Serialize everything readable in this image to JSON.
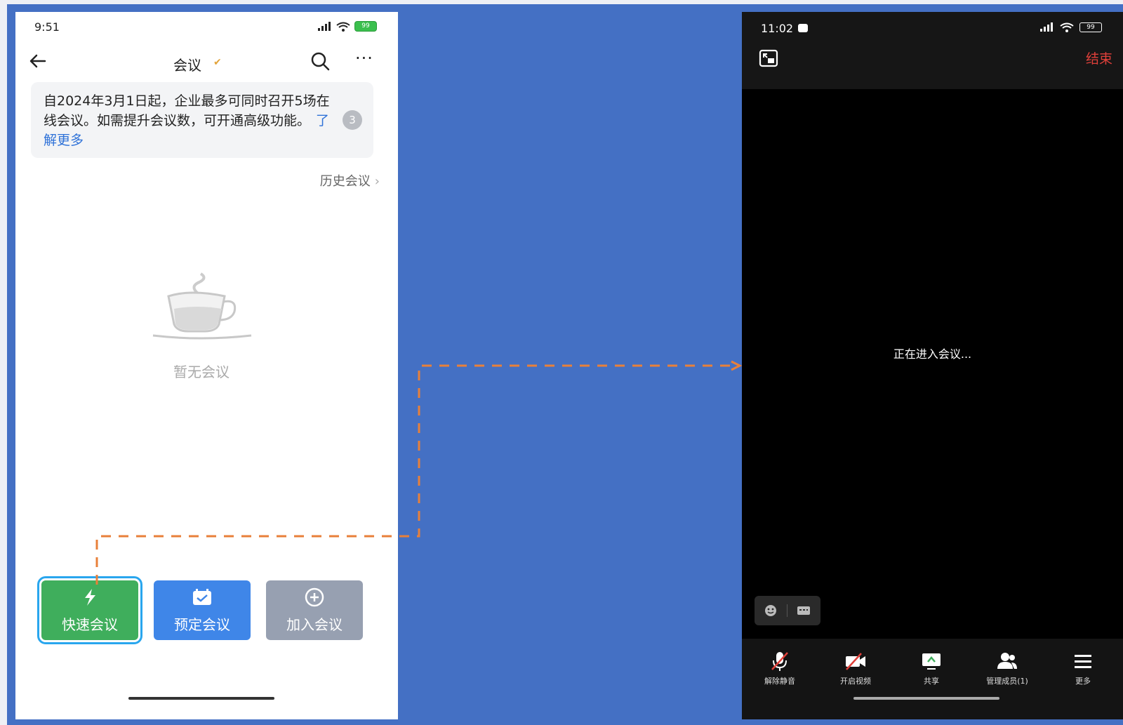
{
  "left_phone": {
    "status": {
      "time": "9:51",
      "battery": "99"
    },
    "nav": {
      "title": "会议",
      "back_icon": "back-arrow-icon",
      "search_icon": "search-icon",
      "more_label": "···"
    },
    "notice": {
      "text": "自2024年3月1日起，企业最多可同时召开5场在线会议。如需提升会议数，可开通高级功能。",
      "link": "了解更多",
      "badge": "3"
    },
    "history_label": "历史会议",
    "empty_label": "暂无会议",
    "buttons": {
      "quick": "快速会议",
      "schedule": "预定会议",
      "join": "加入会议"
    }
  },
  "right_phone": {
    "status": {
      "time": "11:02",
      "battery": "99"
    },
    "end_label": "结束",
    "entering_label": "正在进入会议...",
    "toolbar": [
      {
        "label": "解除静音",
        "icon": "mic-muted-icon"
      },
      {
        "label": "开启视频",
        "icon": "video-off-icon"
      },
      {
        "label": "共享",
        "icon": "share-screen-icon"
      },
      {
        "label": "管理成员(1)",
        "icon": "members-icon"
      },
      {
        "label": "更多",
        "icon": "menu-icon"
      }
    ]
  },
  "colors": {
    "backdrop": "#4470c4",
    "quick_green": "#3fae5c",
    "schedule_blue": "#3f86e8",
    "join_gray": "#97a0b1",
    "connector_orange": "#e8803a",
    "end_red": "#e0403a"
  }
}
